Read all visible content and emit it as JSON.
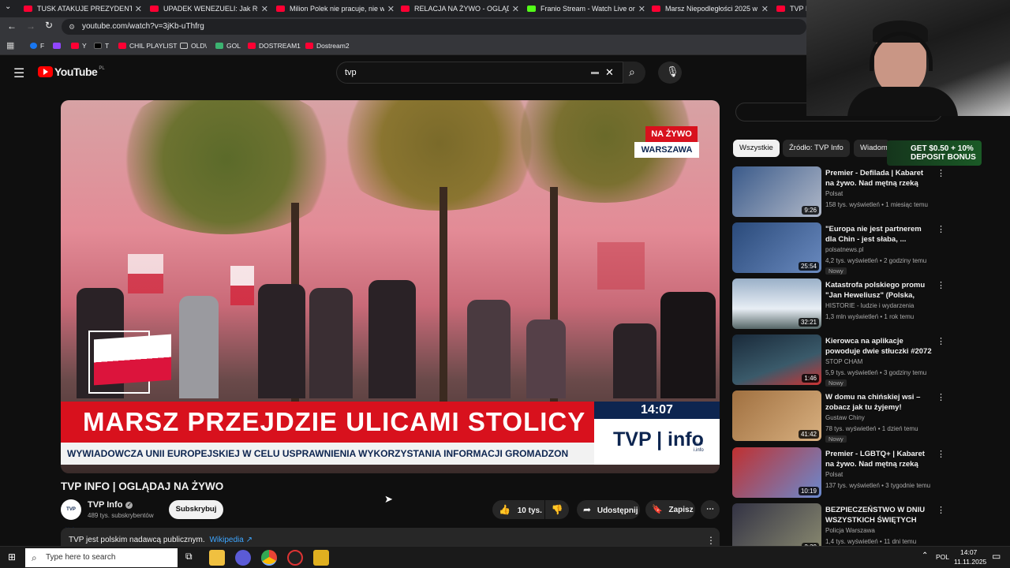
{
  "tabs": [
    {
      "title": "TUSK ATAKUJE PREZYDENTA, JE"
    },
    {
      "title": "UPADEK WENEZUELI: Jak ROPA"
    },
    {
      "title": "Milion Polek nie pracuje, nie w"
    },
    {
      "title": "RELACJA NA ŻYWO - OGLĄDA"
    },
    {
      "title": "Franio Stream - Watch Live on"
    },
    {
      "title": "Marsz Niepodległości 2025 w"
    },
    {
      "title": "TVP II"
    }
  ],
  "address": {
    "url": "youtube.com/watch?v=3jKb-uThfrg"
  },
  "bookmarks": [
    {
      "label": "F"
    },
    {
      "label": ""
    },
    {
      "label": "Y"
    },
    {
      "label": "T"
    },
    {
      "label": "CHIL PLAYLIST"
    },
    {
      "label": "OLD\\"
    },
    {
      "label": "GOL"
    },
    {
      "label": "DOSTREAM1"
    },
    {
      "label": "Dostream2"
    }
  ],
  "youtube": {
    "logo_text": "YouTube",
    "region": "PL",
    "search_value": "tvp"
  },
  "video": {
    "badge_live": "NA ŻYWO",
    "badge_city": "WARSZAWA",
    "headline": "MARSZ PRZEJDZIE ULICAMI STOLICY",
    "clock": "14:07",
    "channel_logo": "TVP | info",
    "ticker": "WYWIADOWCZA UNII EUROPEJSKIEJ W CELU USPRAWNIENIA WYKORZYSTANIA INFORMACJI GROMADZON",
    "corner_logo": "TVP i.info"
  },
  "watch": {
    "title": "TVP INFO | OGLĄDAJ NA ŻYWO",
    "channel_name": "TVP Info",
    "channel_avatar_text": "TVP i.info",
    "subscribers": "489 tys. subskrybentów",
    "subscribe_label": "Subskrybuj",
    "likes": "10 tys.",
    "share_label": "Udostępnij",
    "save_label": "Zapisz",
    "description": "TVP jest polskim nadawcą publicznym.",
    "description_link": "Wikipedia ↗"
  },
  "chips": [
    {
      "label": "Wszystkie"
    },
    {
      "label": "Źródło: TVP Info"
    },
    {
      "label": "Wiadom"
    }
  ],
  "promo": {
    "text": "GET $0.50 + 10% DEPOSIT BONUS"
  },
  "recommendations": [
    {
      "title": "Premier - Defilada | Kabaret na żywo. Nad mętną rzeką",
      "channel": "Polsat",
      "views": "158 tys. wyświetleń",
      "age": "1 miesiąc temu",
      "duration": "9:26",
      "new": ""
    },
    {
      "title": "\"Europa nie jest partnerem dla Chin - jest słaba, ...",
      "channel": "polsatnews.pl",
      "views": "4,2 tys. wyświetleń",
      "age": "2 godziny temu",
      "duration": "25:54",
      "new": "Nowy"
    },
    {
      "title": "Katastrofa polskiego promu \"Jan Heweliusz\" (Polska, 1993...",
      "channel": "HISTORIE - ludzie i wydarzenia",
      "views": "1,3 mln wyświetleń",
      "age": "1 rok temu",
      "duration": "32:21",
      "new": ""
    },
    {
      "title": "Kierowca na aplikacje powoduje dwie stłuczki #2072 Wasze ...",
      "channel": "STOP CHAM",
      "views": "5,9 tys. wyświetleń",
      "age": "3 godziny temu",
      "duration": "1:46",
      "new": "Nowy"
    },
    {
      "title": "W domu na chińskiej wsi – zobacz jak tu żyjemy!",
      "channel": "Gustaw Chiny",
      "views": "78 tys. wyświetleń",
      "age": "1 dzień temu",
      "duration": "41:42",
      "new": "Nowy"
    },
    {
      "title": "Premier - LGBTQ+ | Kabaret na żywo. Nad mętną rzeką",
      "channel": "Polsat",
      "views": "137 tys. wyświetleń",
      "age": "3 tygodnie temu",
      "duration": "10:19",
      "new": ""
    },
    {
      "title": "BEZPIECZEŃSTWO W DNIU WSZYSTKICH ŚWIĘTYCH",
      "channel": "Policja Warszawa",
      "views": "1,4 tys. wyświetleń",
      "age": "11 dni temu",
      "duration": "2:29",
      "new": ""
    }
  ],
  "taskbar": {
    "search_placeholder": "Type here to search",
    "language": "POL",
    "time": "14:07",
    "date": "11.11.2025"
  },
  "colors": {
    "youtube_red": "#ff0000",
    "tvp_red": "#d8111d",
    "tvp_navy": "#0d2550",
    "background": "#0f0f0f"
  }
}
